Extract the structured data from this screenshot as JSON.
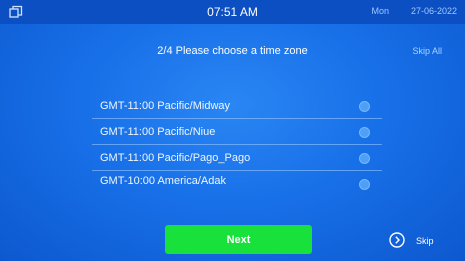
{
  "status_bar": {
    "left_icon": "window-icon",
    "time": "07:51 AM",
    "day": "Mon",
    "date": "27-06-2022"
  },
  "header": {
    "title": "2/4 Please choose a time zone",
    "skip_all_label": "Skip All"
  },
  "timezones": [
    {
      "label": "GMT-11:00 Pacific/Midway"
    },
    {
      "label": "GMT-11:00 Pacific/Niue"
    },
    {
      "label": "GMT-11:00 Pacific/Pago_Pago"
    },
    {
      "label": "GMT-10:00 America/Adak"
    }
  ],
  "footer": {
    "next_label": "Next",
    "skip_icon": "chevron-right-circle-icon",
    "skip_label": "Skip"
  },
  "colors": {
    "background": "#1870e8",
    "accent_button": "#18e13b"
  }
}
